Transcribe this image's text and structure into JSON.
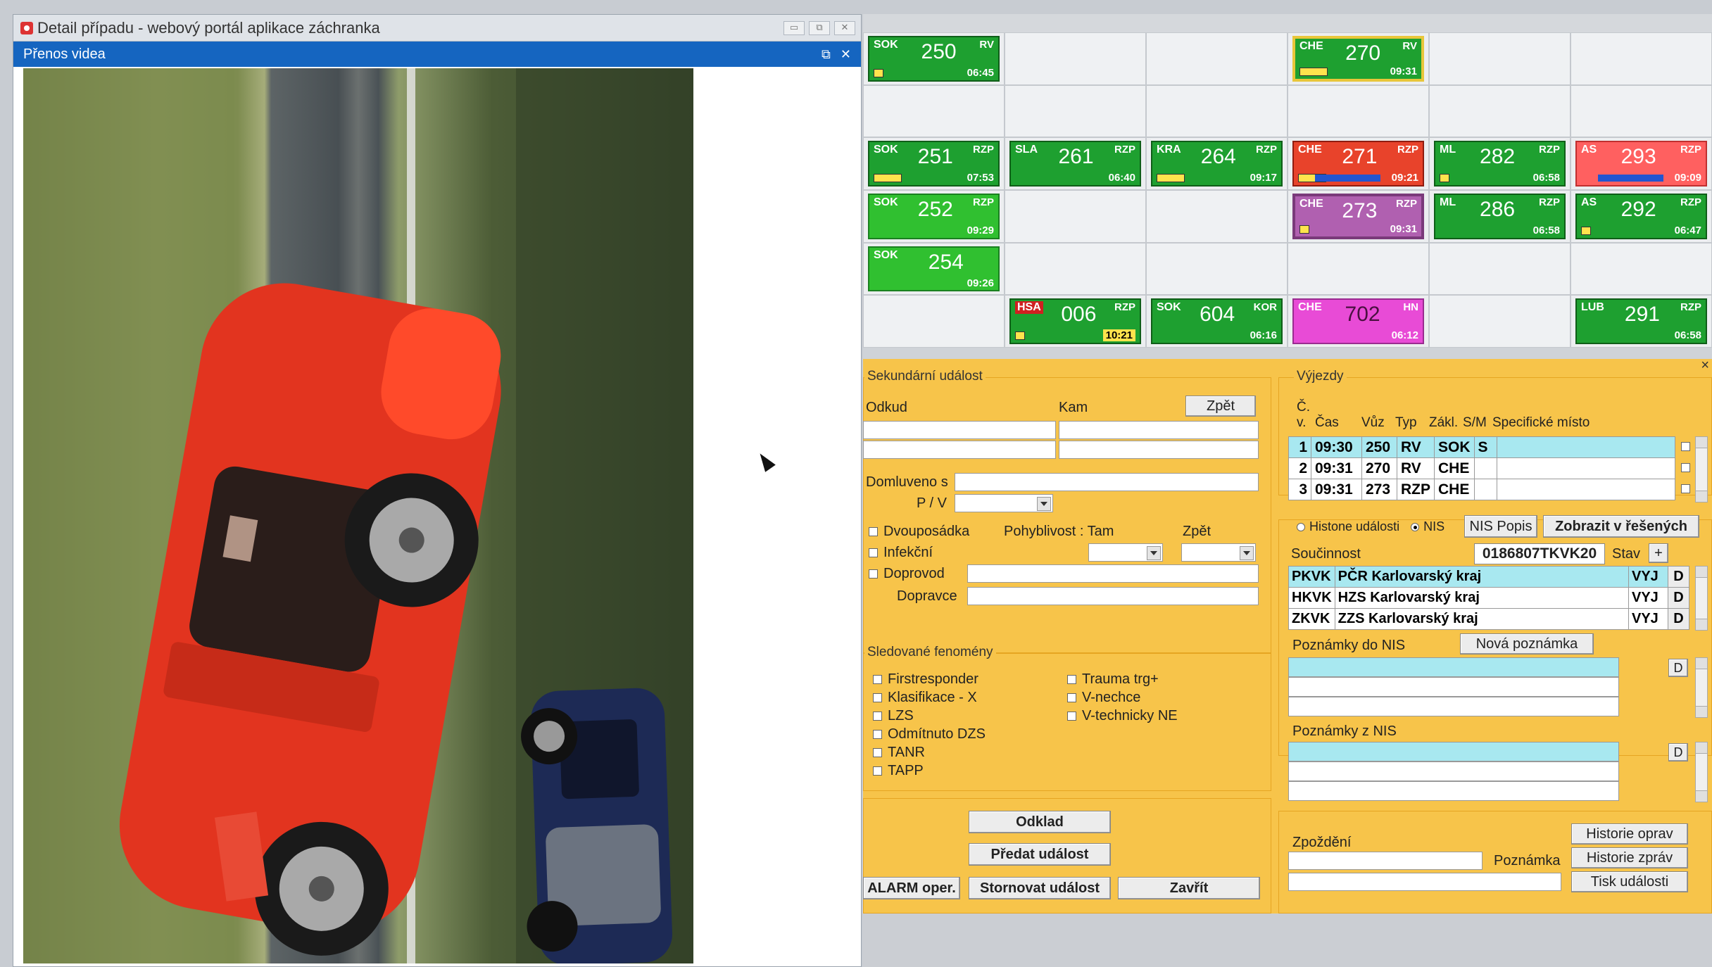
{
  "popup": {
    "title": "Detail případu - webový portál aplikace záchranka",
    "panel_title": "Přenos videa",
    "controls": [
      "▭",
      "⧉",
      "✕"
    ],
    "panel_controls": [
      "⧉",
      "✕"
    ]
  },
  "grid": {
    "units": [
      {
        "code": "SOK",
        "num": "250",
        "status": "RV",
        "time": "06:45",
        "style": "green"
      },
      {
        "code": "CHE",
        "num": "270",
        "status": "RV",
        "time": "09:31",
        "style": "yellow-frame"
      },
      {
        "code": "SOK",
        "num": "251",
        "status": "RZP",
        "time": "07:53",
        "style": "green"
      },
      {
        "code": "SLA",
        "num": "261",
        "status": "RZP",
        "time": "06:40",
        "style": "green"
      },
      {
        "code": "KRA",
        "num": "264",
        "status": "RZP",
        "time": "09:17",
        "style": "green"
      },
      {
        "code": "CHE",
        "num": "271",
        "status": "RZP",
        "time": "09:21",
        "style": "red"
      },
      {
        "code": "ML",
        "num": "282",
        "status": "RZP",
        "time": "06:58",
        "style": "green"
      },
      {
        "code": "AS",
        "num": "293",
        "status": "RZP",
        "time": "09:09",
        "style": "salmon"
      },
      {
        "code": "SOK",
        "num": "252",
        "status": "RZP",
        "time": "09:29",
        "style": "light"
      },
      {
        "code": "CHE",
        "num": "273",
        "status": "RZP",
        "time": "09:31",
        "style": "purple-frame"
      },
      {
        "code": "ML",
        "num": "286",
        "status": "RZP",
        "time": "06:58",
        "style": "green"
      },
      {
        "code": "AS",
        "num": "292",
        "status": "RZP",
        "time": "06:47",
        "style": "green"
      },
      {
        "code": "SOK",
        "num": "254",
        "status": "RZP",
        "time": "09:26",
        "style": "light"
      },
      {
        "code": "HSA",
        "num": "006",
        "status": "RZP",
        "time": "10:21",
        "style": "green"
      },
      {
        "code": "SOK",
        "num": "604",
        "status": "KOR",
        "time": "06:16",
        "style": "green"
      },
      {
        "code": "CHE",
        "num": "702",
        "status": "HN",
        "time": "06:12",
        "style": "pink"
      },
      {
        "code": "LUB",
        "num": "291",
        "status": "RZP",
        "time": "06:58",
        "style": "green"
      }
    ]
  },
  "secondary": {
    "legend": "Sekundární událost",
    "odkud": "Odkud",
    "kam": "Kam",
    "zpet_btn": "Zpět",
    "domluveno": "Domluveno s",
    "pv": "P / V",
    "dvouposadka": "Dvouposádka",
    "pohyblivost": "Pohyblivost : Tam",
    "zpet_lbl": "Zpět",
    "infekcni": "Infekční",
    "doprovod": "Doprovod",
    "dopravce": "Dopravce"
  },
  "phenomena": {
    "legend": "Sledované fenomény",
    "left": [
      "Firstresponder",
      "Klasifikace - X",
      "LZS",
      "Odmítnuto DZS",
      "TANR",
      "TAPP"
    ],
    "right": [
      "Trauma trg+",
      "V-nechce",
      "V-technicky NE"
    ]
  },
  "actions": {
    "odklad": "Odklad",
    "predat": "Předat událost",
    "alarm": "ALARM oper.",
    "stornovat": "Stornovat událost",
    "zavrit": "Zavřít"
  },
  "vyjezdy": {
    "legend": "Výjezdy",
    "header_c": "Č.",
    "headers": [
      "v.",
      "Čas",
      "Vůz",
      "Typ",
      "Zákl.",
      "S/M",
      "Specifické místo"
    ],
    "rows": [
      [
        "1",
        "09:30",
        "250",
        "RV",
        "SOK",
        "S",
        ""
      ],
      [
        "2",
        "09:31",
        "270",
        "RV",
        "CHE",
        "",
        ""
      ],
      [
        "3",
        "09:31",
        "273",
        "RZP",
        "CHE",
        "",
        ""
      ]
    ]
  },
  "nis": {
    "historie": "Histone události",
    "nis": "NIS",
    "nis_popis": "NIS Popis",
    "zobrazit": "Zobrazit v řešených",
    "soucinnost": "Součinnost",
    "id": "0186807TKVK20",
    "stav": "Stav",
    "plus": "+",
    "agencies": [
      [
        "PKVK",
        "PČR Karlovarský kraj",
        "VYJ"
      ],
      [
        "HKVK",
        "HZS Karlovarský kraj",
        "VYJ"
      ],
      [
        "ZKVK",
        "ZZS Karlovarský kraj",
        "VYJ"
      ]
    ],
    "d": "D",
    "poznamky_do": "Poznámky do NIS",
    "nova_poznamka": "Nová poznámka",
    "poznamky_z": "Poznámky z NIS"
  },
  "bottom_right": {
    "zpozdeni": "Zpoždění",
    "poznamka": "Poznámka",
    "historie_oprav": "Historie oprav",
    "historie_zprav": "Historie zpráv",
    "tisk": "Tisk události"
  }
}
